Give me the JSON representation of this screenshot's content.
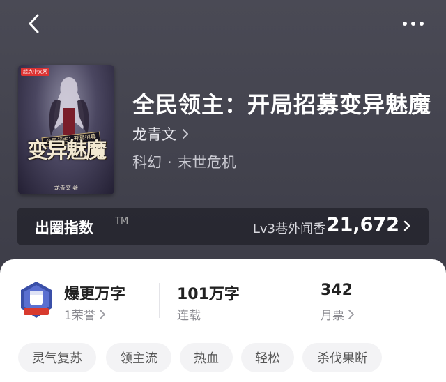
{
  "book": {
    "title": "全民领主：开局招募变异魅魔",
    "author": "龙青文",
    "genre": "科幻",
    "subgenre": "末世危机",
    "cover": {
      "publisher_badge": "起点中文网",
      "title_art": "变异魅魔",
      "subtitle_art": "全民领主：开局招募",
      "author_line": "龙青文 著"
    }
  },
  "index_card": {
    "label": "出圈指数",
    "trademark": "TM",
    "level": "Lv3巷外闻香",
    "value": "21,672"
  },
  "stats": {
    "honor_title": "爆更万字",
    "honor_sub": "1荣誉",
    "words_title": "101万字",
    "words_sub": "连载",
    "tickets_title": "342",
    "tickets_sub": "月票"
  },
  "tags": [
    "灵气复苏",
    "领主流",
    "热血",
    "轻松",
    "杀伐果断"
  ],
  "icons": {
    "back": "chevron-left-icon",
    "more": "more-dots-icon",
    "chevron": "chevron-right-icon",
    "badge": "fist-honor-badge-icon"
  },
  "colors": {
    "header_bg": "#45454f",
    "sheet_bg": "#ffffff",
    "tag_bg": "#f3f3f5",
    "badge_blue": "#3a4fa8",
    "badge_red": "#d83a2e"
  }
}
